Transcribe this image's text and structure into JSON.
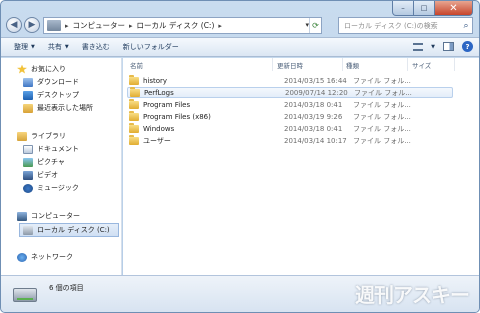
{
  "address": {
    "crumbs": [
      "コンピューター",
      "ローカル ディスク (C:)"
    ],
    "separator": "▸",
    "search_placeholder": "ローカル ディスク (C:)の検索"
  },
  "toolbar": {
    "organize": "整理",
    "share": "共有",
    "burn": "書き込む",
    "new_folder": "新しいフォルダー"
  },
  "navpane": {
    "favorites": "お気に入り",
    "favorites_items": [
      "ダウンロード",
      "デスクトップ",
      "最近表示した場所"
    ],
    "libraries": "ライブラリ",
    "libraries_items": [
      "ドキュメント",
      "ピクチャ",
      "ビデオ",
      "ミュージック"
    ],
    "computer": "コンピューター",
    "computer_items": [
      "ローカル ディスク (C:)"
    ],
    "network": "ネットワーク"
  },
  "columns": {
    "name": "名前",
    "date": "更新日時",
    "type": "種類",
    "size": "サイズ"
  },
  "files": [
    {
      "name": "history",
      "date": "2014/03/15 16:44",
      "type": "ファイル フォル..."
    },
    {
      "name": "PerfLogs",
      "date": "2009/07/14 12:20",
      "type": "ファイル フォル..."
    },
    {
      "name": "Program Files",
      "date": "2014/03/18 0:41",
      "type": "ファイル フォル..."
    },
    {
      "name": "Program Files (x86)",
      "date": "2014/03/19 9:26",
      "type": "ファイル フォル..."
    },
    {
      "name": "Windows",
      "date": "2014/03/18 0:41",
      "type": "ファイル フォル..."
    },
    {
      "name": "ユーザー",
      "date": "2014/03/14 10:17",
      "type": "ファイル フォル..."
    }
  ],
  "status": {
    "item_count": "6 個の項目",
    "watermark": "週刊アスキー"
  },
  "colors": {
    "folder": "#e1ad31",
    "selection": "#cfdff3",
    "window_frame": "#b3cbe6"
  }
}
